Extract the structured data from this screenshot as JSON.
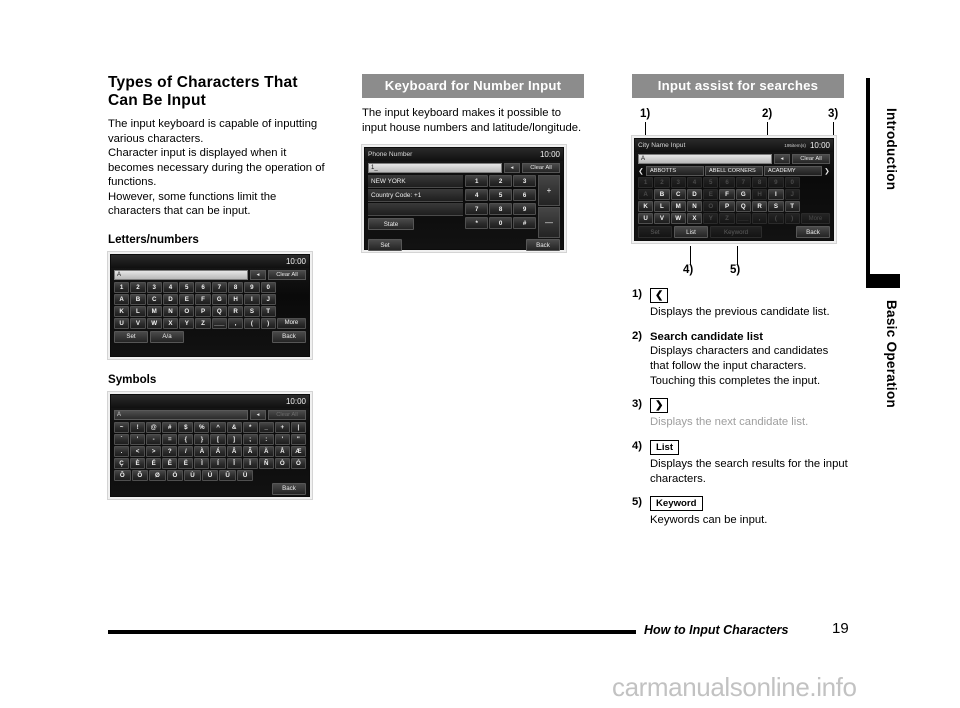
{
  "sidebar": {
    "tabs": [
      {
        "label": "Introduction"
      },
      {
        "label": "Basic Operation"
      }
    ]
  },
  "column1": {
    "title": "Types of Characters That Can Be Input",
    "body": "The input keyboard is capable of inputting various characters.\nCharacter input is displayed when it becomes necessary during the operation of functions.\nHowever, some functions limit the characters that can be input.",
    "subheading_letters": "Letters/numbers",
    "subheading_symbols": "Symbols"
  },
  "column2": {
    "header": "Keyboard for Number Input",
    "body": "The input keyboard makes it possible to input house numbers and latitude/longitude."
  },
  "column3": {
    "header": "Input assist for searches"
  },
  "letters_keyboard": {
    "clock": "10:00",
    "field_value": "A",
    "backspace_icon": "backspace-arrow-icon",
    "clear_all_label": "Clear All",
    "rows": [
      [
        "1",
        "2",
        "3",
        "4",
        "5",
        "6",
        "7",
        "8",
        "9",
        "0"
      ],
      [
        "A",
        "B",
        "C",
        "D",
        "E",
        "F",
        "G",
        "H",
        "I",
        "J"
      ],
      [
        "K",
        "L",
        "M",
        "N",
        "O",
        "P",
        "Q",
        "R",
        "S",
        "T"
      ],
      [
        "U",
        "V",
        "W",
        "X",
        "Y",
        "Z",
        "___",
        ",",
        "(",
        ")"
      ]
    ],
    "more_label": "More",
    "set_label": "Set",
    "case_label": "A/a",
    "back_label": "Back"
  },
  "symbols_keyboard": {
    "clock": "10:00",
    "field_value": "A",
    "backspace_icon": "backspace-arrow-icon",
    "clear_all_label": "Clear All",
    "rows": [
      [
        "~",
        "!",
        "@",
        "#",
        "$",
        "%",
        "^",
        "&",
        "*",
        "_",
        "+",
        "|"
      ],
      [
        "`",
        "'",
        "-",
        "=",
        "{",
        "}",
        "[",
        "]",
        ";",
        ":",
        "'",
        "\""
      ],
      [
        ".",
        "<",
        ">",
        "?",
        "/",
        "À",
        "Á",
        "Â",
        "Ã",
        "Ä",
        "Å",
        "Æ"
      ],
      [
        "Ç",
        "È",
        "É",
        "Ê",
        "Ë",
        "Ì",
        "Í",
        "Î",
        "Ï",
        "Ñ",
        "Ò",
        "Ó"
      ],
      [
        "Ô",
        "Õ",
        "Ø",
        "Ö",
        "Ù",
        "Ú",
        "Û",
        "Ü",
        "",
        "",
        ""
      ]
    ],
    "back_label": "Back"
  },
  "number_keyboard": {
    "title": "Phone Number",
    "clock": "10:00",
    "field_value": "1_",
    "backspace_icon": "backspace-arrow-icon",
    "clear_all_label": "Clear All",
    "list_lines": [
      "NEW YORK",
      "Country Code: +1",
      ""
    ],
    "state_label": "State",
    "keys": [
      [
        "1",
        "2",
        "3"
      ],
      [
        "4",
        "5",
        "6"
      ],
      [
        "7",
        "8",
        "9"
      ],
      [
        "*",
        "0",
        "#"
      ]
    ],
    "op_plus": "+",
    "op_minus": "—",
    "set_label": "Set",
    "back_label": "Back"
  },
  "assist_keyboard": {
    "title": "City Name Input",
    "item_count": "195item(s)",
    "clock": "10:00",
    "field_value": "A",
    "backspace_icon": "backspace-arrow-icon",
    "clear_all_label": "Clear All",
    "prev_arrow_icon": "chevron-left-icon",
    "next_arrow_icon": "chevron-right-icon",
    "candidates": [
      "ABBOTTS",
      "ABELL CORNERS",
      "ACADEMY"
    ],
    "rows": [
      [
        {
          "k": "1",
          "on": false
        },
        {
          "k": "2",
          "on": false
        },
        {
          "k": "3",
          "on": false
        },
        {
          "k": "4",
          "on": false
        },
        {
          "k": "5",
          "on": false
        },
        {
          "k": "6",
          "on": false
        },
        {
          "k": "7",
          "on": false
        },
        {
          "k": "8",
          "on": false
        },
        {
          "k": "9",
          "on": false
        },
        {
          "k": "0",
          "on": false
        }
      ],
      [
        {
          "k": "A",
          "on": false
        },
        {
          "k": "B",
          "on": true
        },
        {
          "k": "C",
          "on": true
        },
        {
          "k": "D",
          "on": true
        },
        {
          "k": "E",
          "on": false
        },
        {
          "k": "F",
          "on": true
        },
        {
          "k": "G",
          "on": true
        },
        {
          "k": "H",
          "on": false
        },
        {
          "k": "I",
          "on": true
        },
        {
          "k": "J",
          "on": false
        }
      ],
      [
        {
          "k": "K",
          "on": true
        },
        {
          "k": "L",
          "on": true
        },
        {
          "k": "M",
          "on": true
        },
        {
          "k": "N",
          "on": true
        },
        {
          "k": "O",
          "on": false
        },
        {
          "k": "P",
          "on": true
        },
        {
          "k": "Q",
          "on": true
        },
        {
          "k": "R",
          "on": true
        },
        {
          "k": "S",
          "on": true
        },
        {
          "k": "T",
          "on": true
        }
      ],
      [
        {
          "k": "U",
          "on": true
        },
        {
          "k": "V",
          "on": true
        },
        {
          "k": "W",
          "on": true
        },
        {
          "k": "X",
          "on": true
        },
        {
          "k": "Y",
          "on": false
        },
        {
          "k": "Z",
          "on": false
        },
        {
          "k": "___",
          "on": false
        },
        {
          "k": ",",
          "on": false
        },
        {
          "k": "(",
          "on": false
        },
        {
          "k": ")",
          "on": false
        }
      ]
    ],
    "more_label": "More",
    "set_label": "Set",
    "list_label": "List",
    "keyword_label": "Keyword",
    "back_label": "Back"
  },
  "callouts": {
    "c1": "1)",
    "c2": "2)",
    "c3": "3)",
    "c4": "4)",
    "c5": "5)"
  },
  "descriptions": [
    {
      "num": "1)",
      "cap": "❮",
      "cap_kind": "arrow",
      "head": "",
      "text": "Displays the previous candidate list.",
      "faded": false
    },
    {
      "num": "2)",
      "cap": "",
      "cap_kind": "none",
      "head": "Search candidate list",
      "text": "Displays characters and candidates that follow the input characters.\nTouching this completes the input.",
      "faded": false
    },
    {
      "num": "3)",
      "cap": "❯",
      "cap_kind": "arrow",
      "head": "",
      "text": "Displays the next candidate list.",
      "faded": true
    },
    {
      "num": "4)",
      "cap": "List",
      "cap_kind": "label",
      "head": "",
      "text": "Displays the search results for the input characters.",
      "faded": false
    },
    {
      "num": "5)",
      "cap": "Keyword",
      "cap_kind": "label",
      "head": "",
      "text": "Keywords can be input.",
      "faded": false
    }
  ],
  "footer": {
    "title": "How to Input Characters",
    "page": "19"
  },
  "watermark": "carmanualsonline.info"
}
